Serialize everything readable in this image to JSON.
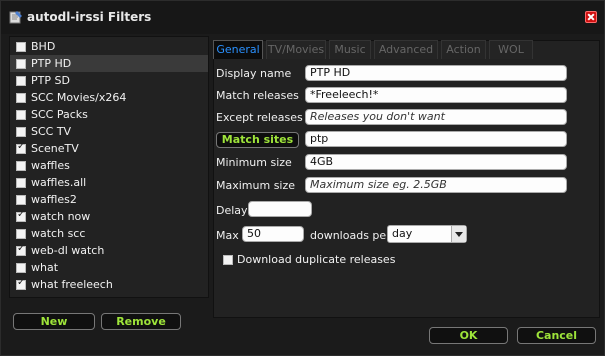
{
  "window": {
    "title": "autodl-irssi Filters"
  },
  "filters": [
    {
      "label": "BHD",
      "checked": false,
      "selected": false
    },
    {
      "label": "PTP HD",
      "checked": false,
      "selected": true
    },
    {
      "label": "PTP SD",
      "checked": false,
      "selected": false
    },
    {
      "label": "SCC Movies/x264",
      "checked": false,
      "selected": false
    },
    {
      "label": "SCC Packs",
      "checked": false,
      "selected": false
    },
    {
      "label": "SCC TV",
      "checked": false,
      "selected": false
    },
    {
      "label": "SceneTV",
      "checked": true,
      "selected": false
    },
    {
      "label": "waffles",
      "checked": false,
      "selected": false
    },
    {
      "label": "waffles.all",
      "checked": false,
      "selected": false
    },
    {
      "label": "waffles2",
      "checked": false,
      "selected": false
    },
    {
      "label": "watch now",
      "checked": true,
      "selected": false
    },
    {
      "label": "watch scc",
      "checked": false,
      "selected": false
    },
    {
      "label": "web-dl watch",
      "checked": true,
      "selected": false
    },
    {
      "label": "what",
      "checked": false,
      "selected": false
    },
    {
      "label": "what freeleech",
      "checked": true,
      "selected": false
    }
  ],
  "buttons": {
    "new": "New",
    "remove": "Remove",
    "ok": "OK",
    "cancel": "Cancel",
    "match_sites": "Match sites"
  },
  "tabs": [
    {
      "label": "General",
      "active": true
    },
    {
      "label": "TV/Movies",
      "active": false
    },
    {
      "label": "Music",
      "active": false
    },
    {
      "label": "Advanced",
      "active": false
    },
    {
      "label": "Action",
      "active": false
    },
    {
      "label": "WOL",
      "active": false
    }
  ],
  "form": {
    "display_name": {
      "label": "Display name",
      "value": "PTP HD"
    },
    "match_releases": {
      "label": "Match releases",
      "value": "*Freeleech!*"
    },
    "except_releases": {
      "label": "Except releases",
      "value": "",
      "placeholder": "Releases you don't want"
    },
    "match_sites": {
      "value": "ptp"
    },
    "minimum_size": {
      "label": "Minimum size",
      "value": "4GB"
    },
    "maximum_size": {
      "label": "Maximum size",
      "value": "",
      "placeholder": "Maximum size eg. 2.5GB"
    },
    "delay": {
      "label": "Delay",
      "value": ""
    },
    "max": {
      "label": "Max",
      "value": "50",
      "suffix": "downloads per",
      "period": "day"
    },
    "download_duplicates": {
      "label": "Download duplicate releases",
      "checked": false
    }
  },
  "colors": {
    "accent_green": "#9ee43a",
    "active_tab": "#2a91ff",
    "close_red": "#d01010"
  }
}
